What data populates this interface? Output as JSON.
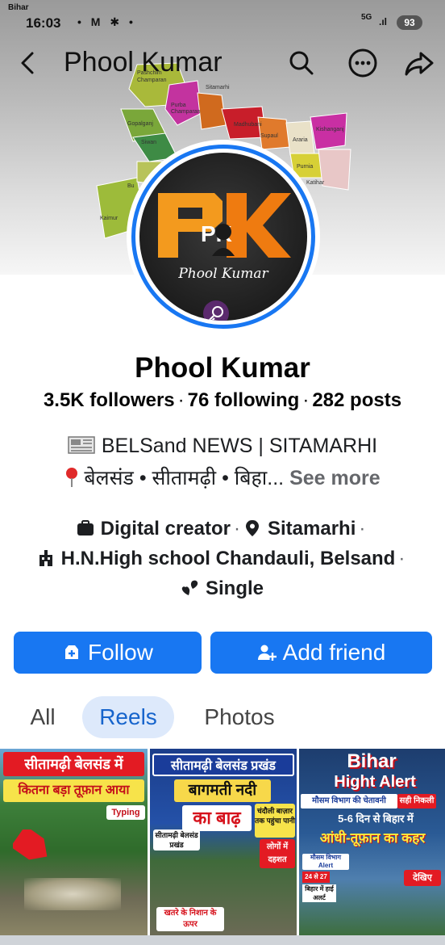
{
  "status_bar": {
    "carrier": "Bihar",
    "time": "16:03",
    "notification_icons": "• M ✱ •",
    "network": "5G",
    "signal": ".ıl",
    "battery": "93"
  },
  "header": {
    "title": "Phool Kumar"
  },
  "cover_map": {
    "districts": [
      "Pashchim Champaran",
      "Purba Champaran",
      "Sitamarhi",
      "Madhubani",
      "Supaul",
      "Araria",
      "Kishanganj",
      "Gopalganj",
      "Siwan",
      "Purnia",
      "Katihar",
      "Kaimur",
      "Bu"
    ]
  },
  "avatar": {
    "logo_letters": "PK",
    "name_text": "Phool Kumar"
  },
  "profile": {
    "name": "Phool Kumar",
    "followers": "3.5K followers",
    "following": "76 following",
    "posts": "282 posts",
    "bio_line1": "BELSand NEWS | SITAMARHI",
    "bio_line2": "बेलसंड • सीतामढ़ी • बिहा...",
    "see_more": "See more"
  },
  "details": {
    "category": "Digital creator",
    "location": "Sitamarhi",
    "school": "H.N.High school Chandauli, Belsand",
    "relationship": "Single"
  },
  "actions": {
    "follow": "Follow",
    "add_friend": "Add friend"
  },
  "tabs": [
    {
      "label": "All",
      "selected": false
    },
    {
      "label": "Reels",
      "selected": true
    },
    {
      "label": "Photos",
      "selected": false
    }
  ],
  "reels": [
    {
      "line1": "सीतामढ़ी बेलसंड में",
      "line2": "कितना बड़ा तूफ़ान आया",
      "tag": "Typing"
    },
    {
      "line1": "सीतामढ़ी बेलसंड प्रखंड",
      "line2": "बागमती नदी",
      "line3": "का बाढ़",
      "side_note": "चंदौली बाज़ार तक पहुंचा पानी",
      "small_label": "सीतामढ़ी बेलसंड प्रखंड",
      "red_box": "लोगों में दहशत",
      "warning": "खतरे के निशान के ऊपर"
    },
    {
      "line1": "Bihar",
      "line2": "Hight Alert",
      "line3": "मौसम विभाग की चेतावनी",
      "badge": "सही निकली",
      "line4": "5-6 दिन से बिहार में",
      "line5": "आंधी-तूफ़ान का कहर",
      "small_label": "मौसम विभाग Alert",
      "date_box": "24 से 27",
      "small_label2": "बिहार में हाई अलर्ट",
      "see_label": "देखिए"
    }
  ],
  "colors": {
    "primary": "#1877f2",
    "tab_selected_bg": "#dde9fb",
    "tab_selected_text": "#1664cc",
    "see_more": "#65676b"
  }
}
